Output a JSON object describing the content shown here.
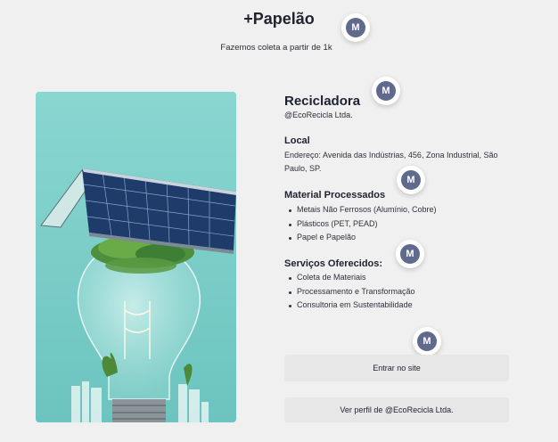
{
  "header": {
    "title": "+Papelão",
    "subtitle": "Fazemos coleta a partir de 1k"
  },
  "avatar_initial": "M",
  "profile": {
    "name": "Recicladora",
    "handle": "@EcoRecicla Ltda."
  },
  "local": {
    "title": "Local",
    "address": "Endereço: Avenida das Indústrias, 456, Zona Industrial, São Paulo, SP."
  },
  "materials": {
    "title": "Material Processados",
    "items": [
      "Metais Não Ferrosos (Alumínio, Cobre)",
      "Plásticos (PET, PEAD)",
      "Papel e Papelão"
    ]
  },
  "services": {
    "title": "Serviços Oferecidos:",
    "items": [
      "Coleta de Materiais",
      "Processamento e Transformação",
      "Consultoria em Sustentabilidade"
    ]
  },
  "buttons": {
    "enter_site": "Entrar no site",
    "view_profile": "Ver perfil de @EcoRecicla Ltda."
  },
  "hero_image": {
    "description_icon": "solar-panel-lightbulb-image"
  }
}
